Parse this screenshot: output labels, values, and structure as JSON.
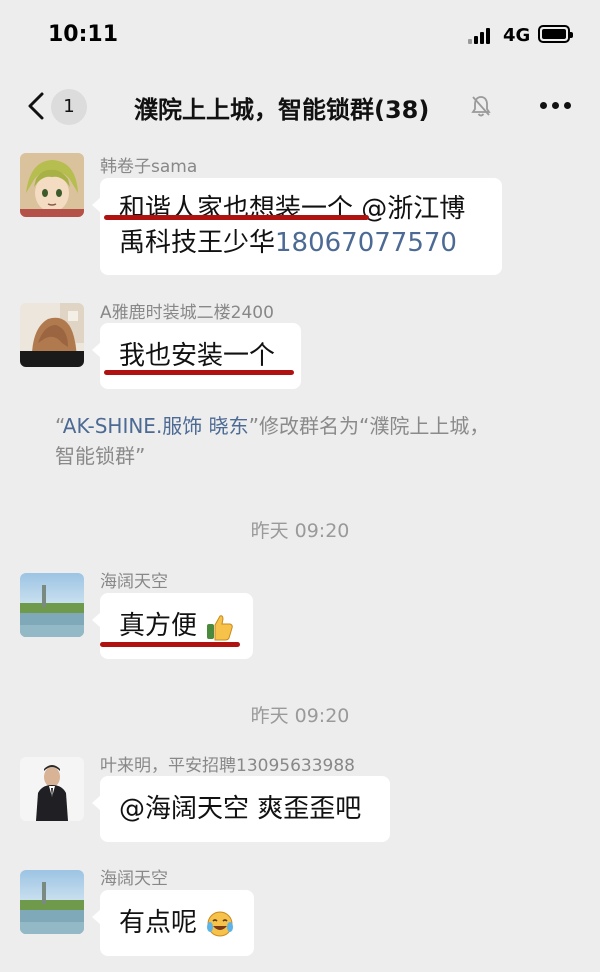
{
  "status_bar": {
    "time": "10:11",
    "network": "4G"
  },
  "nav": {
    "unread_count": "1",
    "title": "濮院上上城，智能锁群(38)"
  },
  "messages": [
    {
      "sender": "韩卷子sama",
      "text_1": "和谐人家也想装一个",
      "text_2": " @浙江博",
      "text_3": "禹科技王少华",
      "phone": "18067077570"
    },
    {
      "sender": "A雅鹿时装城二楼2400",
      "text": "我也安装一个"
    },
    {
      "sender": "海阔天空",
      "text": "真方便"
    },
    {
      "sender": "叶来明，平安招聘13095633988",
      "text": "@海阔天空 爽歪歪吧"
    },
    {
      "sender": "海阔天空",
      "text": "有点呢"
    }
  ],
  "system_notice": {
    "name": "AK-SHINE.服饰 晓东",
    "action": "修改群名为“濮院上上城，",
    "continuation": "智能锁群”"
  },
  "timestamps": [
    "昨天 09:20",
    "昨天 09:20"
  ],
  "icons": {
    "back": "chevron-left-icon",
    "mute": "bell-muted-icon",
    "more": "ellipsis-icon",
    "emoji_1": "thumbs-up-emoji",
    "emoji_2": "laughing-tears-emoji"
  },
  "colors": {
    "highlight_underline": "#b01212",
    "link": "#4c6a93",
    "background": "#ededed"
  }
}
